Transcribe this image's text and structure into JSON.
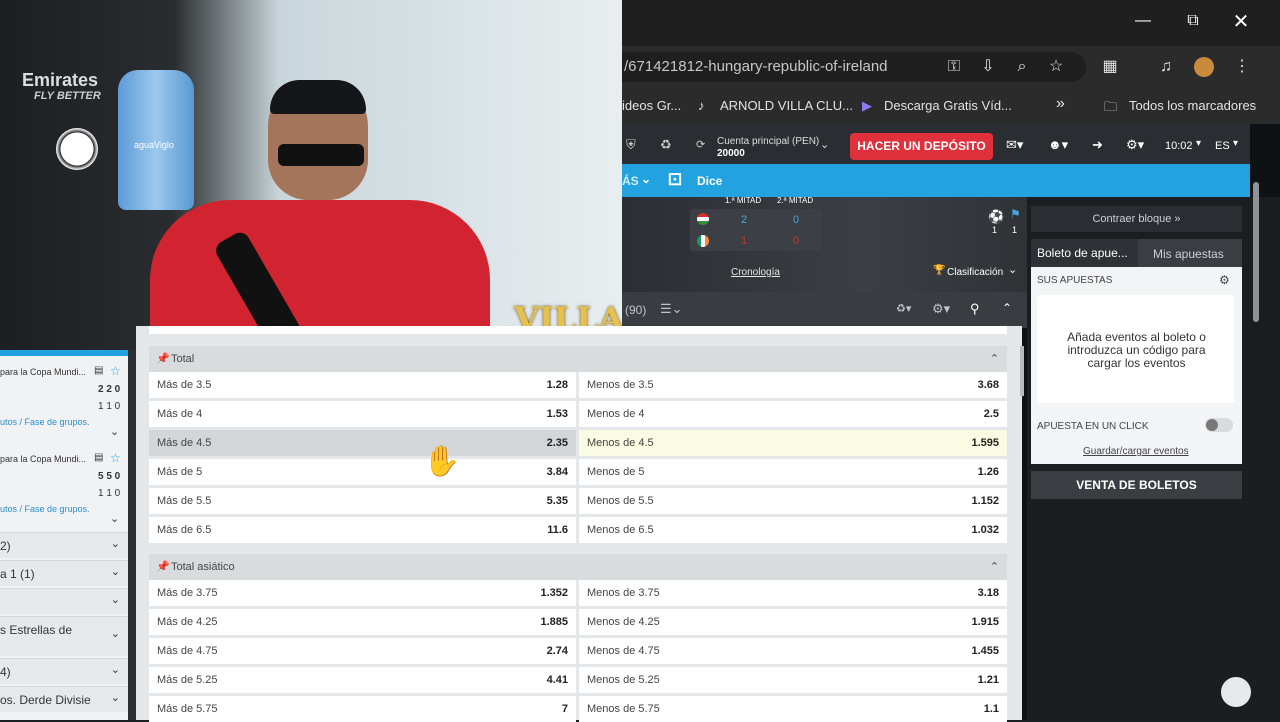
{
  "window": {
    "minimize_icon": "minimize-icon",
    "restore_icon": "restore-icon",
    "close_icon": "close-icon"
  },
  "browser": {
    "url": "/671421812-hungary-republic-of-ireland",
    "bookmarks": [
      "ideos Gr...",
      "ARNOLD VILLA CLU...",
      "Descarga Gratis Víd..."
    ],
    "bookmarks_more": "»",
    "all_bookmarks": "Todos los marcadores"
  },
  "site": {
    "account_label": "Cuenta principal (PEN)",
    "balance": "20000",
    "deposit_label": "HACER UN DEPÓSITO",
    "time": "10:02",
    "lang": "ES",
    "blue_bar": {
      "more": "ÁS",
      "dice": "Dice"
    },
    "scoreboard": {
      "half1": "1.ª MITAD",
      "half2": "2.ª MITAD",
      "row1": [
        "2",
        "0"
      ],
      "row2": [
        "1",
        "0"
      ],
      "side_counts": [
        "1",
        "1"
      ],
      "timeline": "Cronología",
      "standings": "Clasificación"
    },
    "markets_header": {
      "count": "(90)"
    },
    "right": {
      "collapse": "Contraer bloque »",
      "tab_slip": "Boleto de apue...",
      "tab_bets": "Mis apuestas",
      "your_bets": "SUS APUESTAS",
      "empty_msg": "Añada eventos al boleto o introduzca un código para cargar los eventos",
      "one_click": "APUESTA EN UN CLICK",
      "save_load": "Guardar/cargar eventos",
      "sale": "VENTA DE BOLETOS"
    }
  },
  "odds": {
    "total": {
      "title": "Total",
      "rows": [
        [
          "Más de 3.5",
          "1.28",
          "Menos de 3.5",
          "3.68"
        ],
        [
          "Más de 4",
          "1.53",
          "Menos de 4",
          "2.5"
        ],
        [
          "Más de 4.5",
          "2.35",
          "Menos de 4.5",
          "1.595"
        ],
        [
          "Más de 5",
          "3.84",
          "Menos de 5",
          "1.26"
        ],
        [
          "Más de 5.5",
          "5.35",
          "Menos de 5.5",
          "1.152"
        ],
        [
          "Más de 6.5",
          "11.6",
          "Menos de 6.5",
          "1.032"
        ]
      ]
    },
    "asian": {
      "title": "Total asiático",
      "rows": [
        [
          "Más de 3.75",
          "1.352",
          "Menos de 3.75",
          "3.18"
        ],
        [
          "Más de 4.25",
          "1.885",
          "Menos de 4.25",
          "1.915"
        ],
        [
          "Más de 4.75",
          "2.74",
          "Menos de 4.75",
          "1.455"
        ],
        [
          "Más de 5.25",
          "4.41",
          "Menos de 5.25",
          "1.21"
        ],
        [
          "Más de 5.75",
          "7",
          "Menos de 5.75",
          "1.1"
        ]
      ]
    }
  },
  "left": {
    "e1_title": "para la Copa Mundi...",
    "e1_scores": [
      "2 2 0",
      "1 1 0"
    ],
    "e1_sub": "utos / Fase de grupos.",
    "e2_title": "para la Copa Mundi...",
    "e2_scores": [
      "5 5 0",
      "1 1 0"
    ],
    "e2_sub": "utos / Fase de grupos.",
    "items": [
      "2)",
      "a 1 (1)",
      "",
      "s Estrellas de",
      "4)",
      "os. Derde Divisie"
    ]
  },
  "camera": {
    "brand": "Emirates",
    "brand_sub": "FLY BETTER",
    "overlay": "VILLA",
    "bottle": "aguaViglo"
  }
}
